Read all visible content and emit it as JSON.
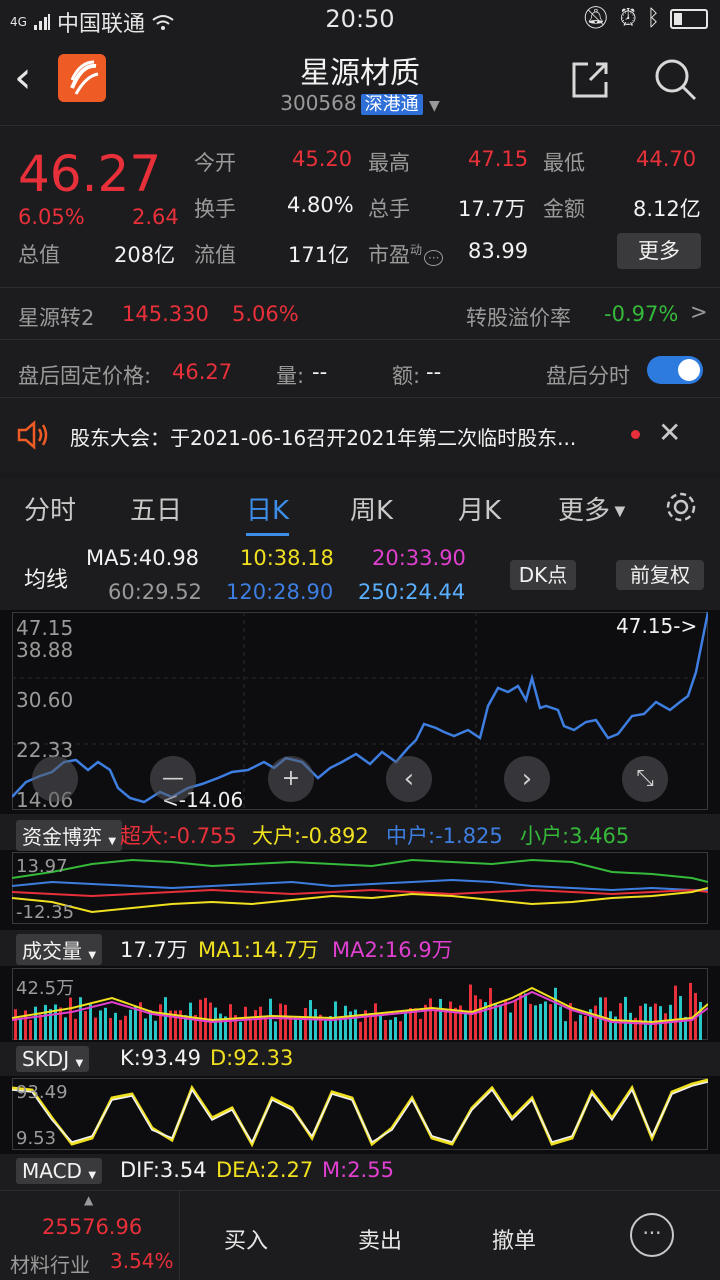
{
  "status": {
    "signal": "4G",
    "carrier": "中国联通",
    "time": "20:50"
  },
  "header": {
    "title": "星源材质",
    "code": "300568",
    "tag": "深港通"
  },
  "quote": {
    "price": "46.27",
    "pct": "6.05%",
    "change": "2.64",
    "open_label": "今开",
    "open": "45.20",
    "high_label": "最高",
    "high": "47.15",
    "low_label": "最低",
    "low": "44.70",
    "turnover_label": "换手",
    "turnover": "4.80%",
    "volume_label": "总手",
    "volume": "17.7万",
    "amount_label": "金额",
    "amount": "8.12亿",
    "mktcap_label": "总值",
    "mktcap": "208亿",
    "float_label": "流值",
    "float": "171亿",
    "pe_label": "市盈",
    "pe_sup": "动",
    "pe": "83.99",
    "more": "更多",
    "bond_name": "星源转2",
    "bond_price": "145.330",
    "bond_pct": "5.06%",
    "premium_label": "转股溢价率",
    "premium": "-0.97%",
    "after_label": "盘后固定价格:",
    "after_price": "46.27",
    "after_vol_label": "量:",
    "after_vol": "--",
    "after_amt_label": "额:",
    "after_amt": "--",
    "after_time_label": "盘后分时"
  },
  "notice": {
    "text": "股东大会：于2021-06-16召开2021年第二次临时股东..."
  },
  "tabs": [
    "分时",
    "五日",
    "日K",
    "周K",
    "月K",
    "更多"
  ],
  "ma": {
    "label": "均线",
    "ma5": "MA5:40.98",
    "ma10": "10:38.18",
    "ma20": "20:33.90",
    "ma60": "60:29.52",
    "ma120": "120:28.90",
    "ma250": "250:24.44",
    "dk": "DK点",
    "adj": "前复权"
  },
  "kline": {
    "y_labels": [
      "47.15",
      "38.88",
      "30.60",
      "22.33",
      "14.06"
    ],
    "max_marker": "47.15->",
    "min_marker": "<-14.06"
  },
  "fund": {
    "label": "资金博弈",
    "super": "超大:-0.755",
    "large": "大户:-0.892",
    "mid": "中户:-1.825",
    "small": "小户:3.465",
    "y_top": "13.97",
    "y_bottom": "-12.35"
  },
  "vol": {
    "label": "成交量",
    "value": "17.7万",
    "ma1": "MA1:14.7万",
    "ma2": "MA2:16.9万",
    "y_top": "42.5万"
  },
  "skdj": {
    "label": "SKDJ",
    "k": "K:93.49",
    "d": "D:92.33",
    "y_top": "93.49",
    "y_bottom": "9.53"
  },
  "macd": {
    "label": "MACD",
    "dif": "DIF:3.54",
    "dea": "DEA:2.27",
    "m": "M:2.55"
  },
  "bottom": {
    "index_value": "25576.96",
    "industry": "材料行业",
    "industry_pct": "3.54%",
    "buy": "买入",
    "sell": "卖出",
    "cancel": "撤单"
  },
  "colors": {
    "up": "#e8303a",
    "down": "#35b93a",
    "accent": "#3d8eea",
    "ma10": "#f0e020",
    "ma20": "#e040d0"
  }
}
